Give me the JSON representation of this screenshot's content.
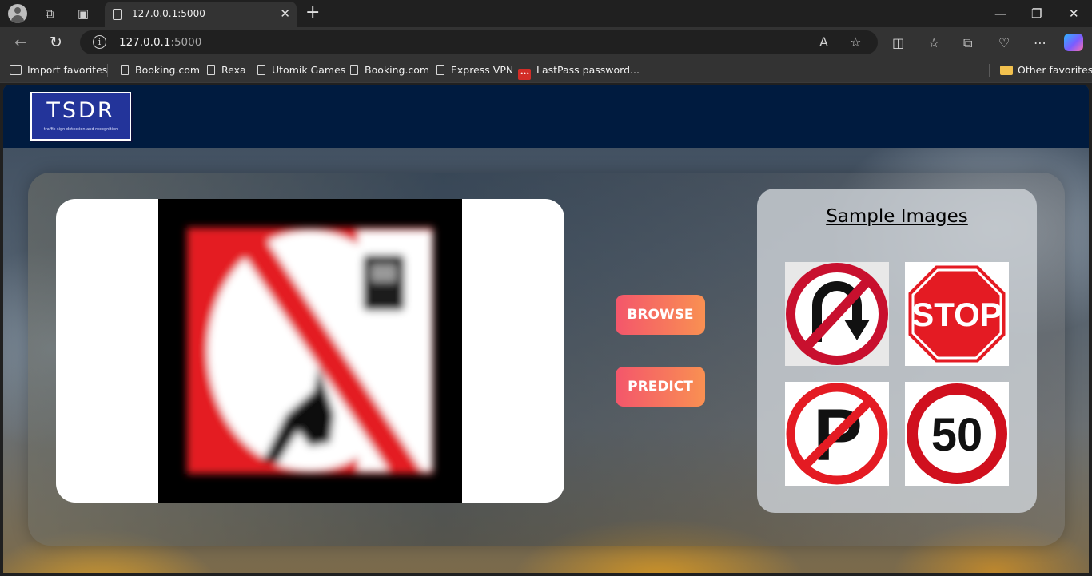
{
  "browser": {
    "tab_title": "127.0.0.1:5000",
    "url_host": "127.0.0.1",
    "url_port": ":5000",
    "bookmarks": [
      {
        "label": "Import favorites"
      },
      {
        "label": "Booking.com"
      },
      {
        "label": "Rexa"
      },
      {
        "label": "Utomik Games"
      },
      {
        "label": "Booking.com"
      },
      {
        "label": "Express VPN"
      },
      {
        "label": "LastPass password..."
      }
    ],
    "other_favorites": "Other favorites"
  },
  "app": {
    "logo_text": "TSDR",
    "logo_subtext": "traffic sign detection and recognition",
    "browse_label": "BROWSE",
    "predict_label": "PREDICT",
    "samples_title": "Sample Images",
    "sample_images": [
      {
        "name": "no-u-turn-sign"
      },
      {
        "name": "stop-sign",
        "text": "STOP"
      },
      {
        "name": "no-parking-sign",
        "text": "P"
      },
      {
        "name": "speed-limit-50-sign",
        "text": "50"
      }
    ]
  },
  "colors": {
    "navbar": "#001b3f",
    "logo_bg": "#23349a",
    "button_gradient_start": "#f4566b",
    "button_gradient_end": "#f99052",
    "sign_red": "#e41b23"
  }
}
